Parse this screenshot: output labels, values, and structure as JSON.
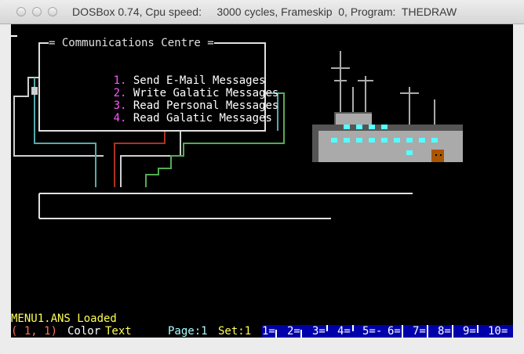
{
  "window": {
    "title": "DOSBox 0.74, Cpu speed:     3000 cycles, Frameskip  0, Program:  THEDRAW"
  },
  "screen": {
    "cursor_glyph": "▬",
    "box_title": "= Communications Centre =",
    "menu_items": [
      {
        "num": "1.",
        "label": "Send E-Mail Messages"
      },
      {
        "num": "2.",
        "label": "Write Galatic Messages"
      },
      {
        "num": "3.",
        "label": "Read Personal Messages"
      },
      {
        "num": "4.",
        "label": "Read Galatic Messages"
      }
    ]
  },
  "status": {
    "message": "MENU1.ANS Loaded",
    "cursor_pos": "( 1, 1)",
    "mode_label": "Color",
    "mode_value": "Text",
    "page_label": "Page:1",
    "set_label": "Set:1",
    "fkeys": [
      {
        "label": "1="
      },
      {
        "label": "2="
      },
      {
        "label": "3="
      },
      {
        "label": "4="
      },
      {
        "label": "5=-"
      },
      {
        "label": "6="
      },
      {
        "label": "7="
      },
      {
        "label": "8="
      },
      {
        "label": "9="
      },
      {
        "label": "10="
      }
    ]
  },
  "colors": {
    "screen_bg": "#000000",
    "menu_number": "#ff55ff",
    "status_yellow": "#ffff55",
    "status_red": "#ff7060",
    "fkey_bar": "#0000aa",
    "ship_hull": "#aaaaaa",
    "ship_windows": "#55ffff",
    "ship_door": "#aa5500",
    "line_cyan": "#55aaaa",
    "line_red": "#aa3322",
    "line_green": "#55aa55"
  }
}
